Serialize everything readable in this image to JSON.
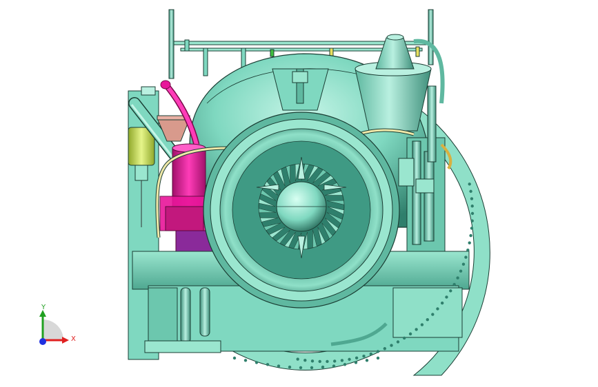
{
  "viewport": {
    "background": "#ffffff"
  },
  "model": {
    "description_icon": "cad-assembly-icon",
    "colors": {
      "body": "#7fd8c0",
      "body_dark": "#2f7f6c",
      "body_light": "#b9f0e0",
      "edge": "#1a3d33",
      "magenta": "#e8169a",
      "pink_tank": "#c2187d",
      "yellow_green": "#c8e05a",
      "purple": "#8a2a9a",
      "cream": "#f0e8a8",
      "salmon": "#d89a8c",
      "gold": "#d8b040"
    }
  },
  "triad": {
    "x_label": "X",
    "y_label": "Y",
    "x_color": "#e02020",
    "y_color": "#20a020",
    "z_color": "#2030e0"
  }
}
